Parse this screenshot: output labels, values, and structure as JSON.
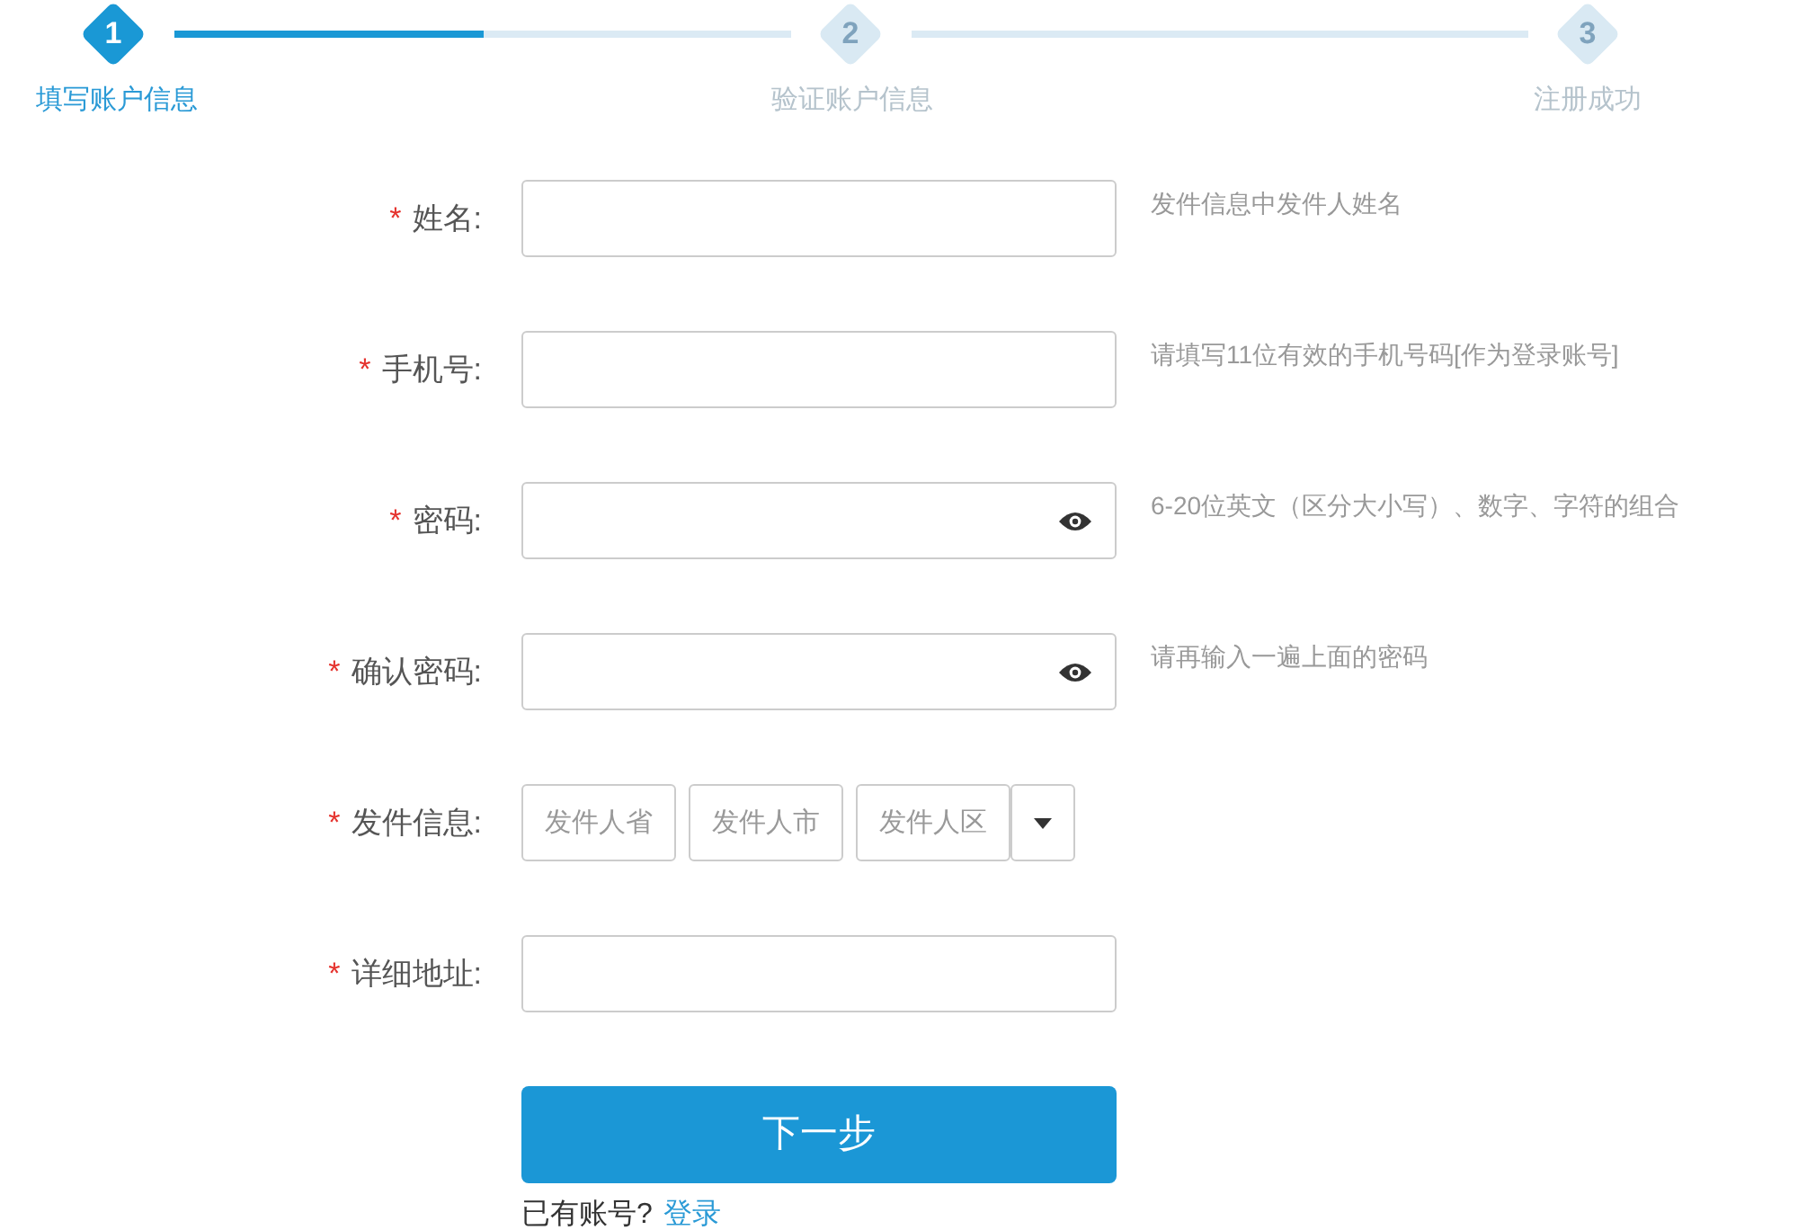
{
  "steps": [
    {
      "number": "1",
      "label": "填写账户信息",
      "selected": true,
      "level": 0.5
    },
    {
      "number": "2",
      "label": "验证账户信息",
      "selected": false,
      "level": 0
    },
    {
      "number": "3",
      "label": "注册成功",
      "selected": false
    }
  ],
  "fields": [
    {
      "kind": "text",
      "mark": "*",
      "label": "姓名:",
      "hint": "发件信息中发件人姓名"
    },
    {
      "kind": "text",
      "mark": "*",
      "label": "手机号:",
      "hint": "请填写11位有效的手机号码[作为登录账号]"
    },
    {
      "kind": "password",
      "mark": "*",
      "label": "密码:",
      "hint": "6-20位英文（区分大小写）、数字、字符的组合"
    },
    {
      "kind": "password",
      "mark": "*",
      "label": "确认密码:",
      "hint": "请再输入一遍上面的密码"
    },
    {
      "kind": "region",
      "mark": "*",
      "label": "发件信息:",
      "placeholders": [
        "发件人省",
        "发件人市",
        "发件人区"
      ]
    },
    {
      "kind": "text",
      "mark": "*",
      "label": "详细地址:"
    }
  ],
  "next_button": "下一步",
  "login_prompt": "已有账号?",
  "login_link": "登录"
}
